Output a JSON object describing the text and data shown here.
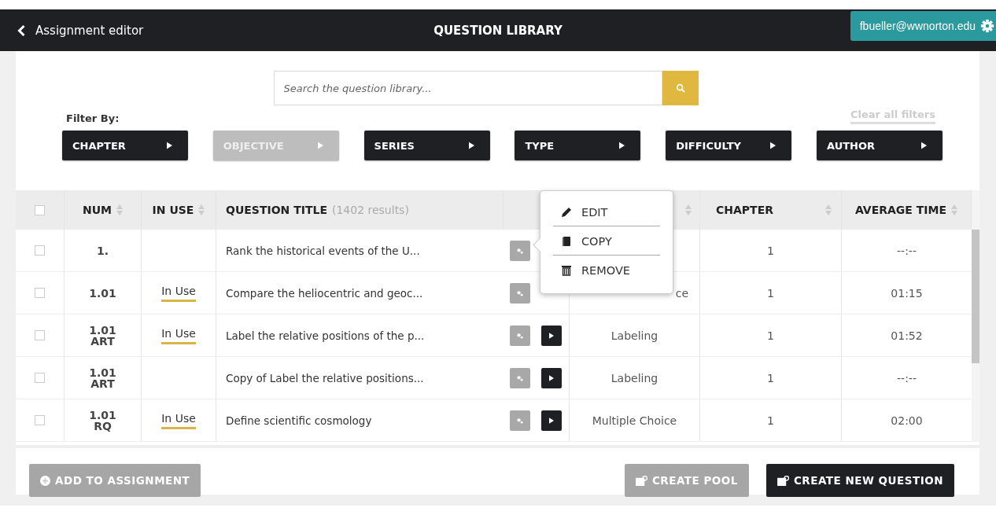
{
  "header": {
    "back_label": "Assignment editor",
    "title": "QUESTION LIBRARY",
    "user": "fbueller@wwnorton.edu"
  },
  "search": {
    "placeholder": "Search the question library..."
  },
  "filter_label": "Filter By:",
  "clear_filters": "Clear all filters",
  "filters": [
    {
      "label": "CHAPTER",
      "disabled": false
    },
    {
      "label": "OBJECTIVE",
      "disabled": true
    },
    {
      "label": "SERIES",
      "disabled": false
    },
    {
      "label": "TYPE",
      "disabled": false
    },
    {
      "label": "DIFFICULTY",
      "disabled": false
    },
    {
      "label": "AUTHOR",
      "disabled": false
    }
  ],
  "table": {
    "select_all_checked": false,
    "columns": [
      {
        "label": "NUM",
        "sortable": true
      },
      {
        "label": "IN USE",
        "sortable": true
      },
      {
        "label": "QUESTION TITLE",
        "note": "(1402 results)",
        "sortable": false
      },
      {},
      {
        "sortable": true
      },
      {
        "label": "CHAPTER",
        "sortable": true
      },
      {
        "label": "AVERAGE TIME",
        "sortable": true
      }
    ],
    "rows": [
      {
        "checked": false,
        "num": "1.",
        "title": "Rank the historical events of the U...",
        "chapter": "1",
        "time": "--:--"
      },
      {
        "checked": false,
        "num": "1.01",
        "in_use": "In Use",
        "title": "Compare the heliocentric and geoc...",
        "type": "ce",
        "chapter": "1",
        "time": "01:15"
      },
      {
        "checked": false,
        "num": "1.01 ART",
        "in_use": "In Use",
        "title": "Label the relative positions of the p...",
        "play": true,
        "type": "Labeling",
        "chapter": "1",
        "time": "01:52"
      },
      {
        "checked": false,
        "num": "1.01 ART",
        "title": "Copy of Label the relative positions...",
        "play": true,
        "type": "Labeling",
        "chapter": "1",
        "time": "--:--"
      },
      {
        "checked": false,
        "num": "1.01 RQ",
        "in_use": "In Use",
        "title": "Define scientific cosmology",
        "play": true,
        "type": "Multiple Choice",
        "chapter": "1",
        "time": "02:00"
      }
    ]
  },
  "menu": [
    {
      "kind": "pencil",
      "label": "EDIT"
    },
    {
      "kind": "copy",
      "label": "COPY"
    },
    {
      "kind": "trash",
      "label": "REMOVE"
    }
  ],
  "footer_buttons": [
    {
      "kind": "plus",
      "label": "ADD TO ASSIGNMENT",
      "disabled": true
    },
    {
      "kind": "new",
      "label": "CREATE POOL",
      "disabled": true
    },
    {
      "kind": "new",
      "label": "CREATE NEW QUESTION",
      "disabled": false
    }
  ]
}
